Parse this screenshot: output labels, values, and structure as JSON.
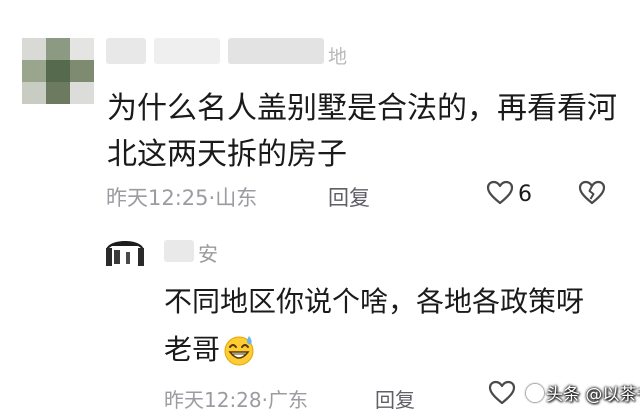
{
  "comments": [
    {
      "name_visible": "地",
      "text": "为什么名人盖别墅是合法的，再看看河北这两天拆的房子",
      "time": "昨天12:25",
      "location": "山东",
      "reply_label": "回复",
      "likes": "6"
    },
    {
      "name_visible": "安",
      "text": "不同地区你说个啥，各地各政策呀老哥",
      "time": "昨天12:28",
      "location": "广东",
      "reply_label": "回复"
    }
  ],
  "separator": "·",
  "watermark": {
    "text": "头条 @以茶书"
  },
  "icons": {
    "like": "heart-outline-icon",
    "dislike": "broken-heart-icon",
    "emoji": "laughing-sweat-emoji"
  },
  "colors": {
    "meta": "#9b9ba1",
    "reply": "#5f5f66",
    "text": "#1a1a1a"
  }
}
